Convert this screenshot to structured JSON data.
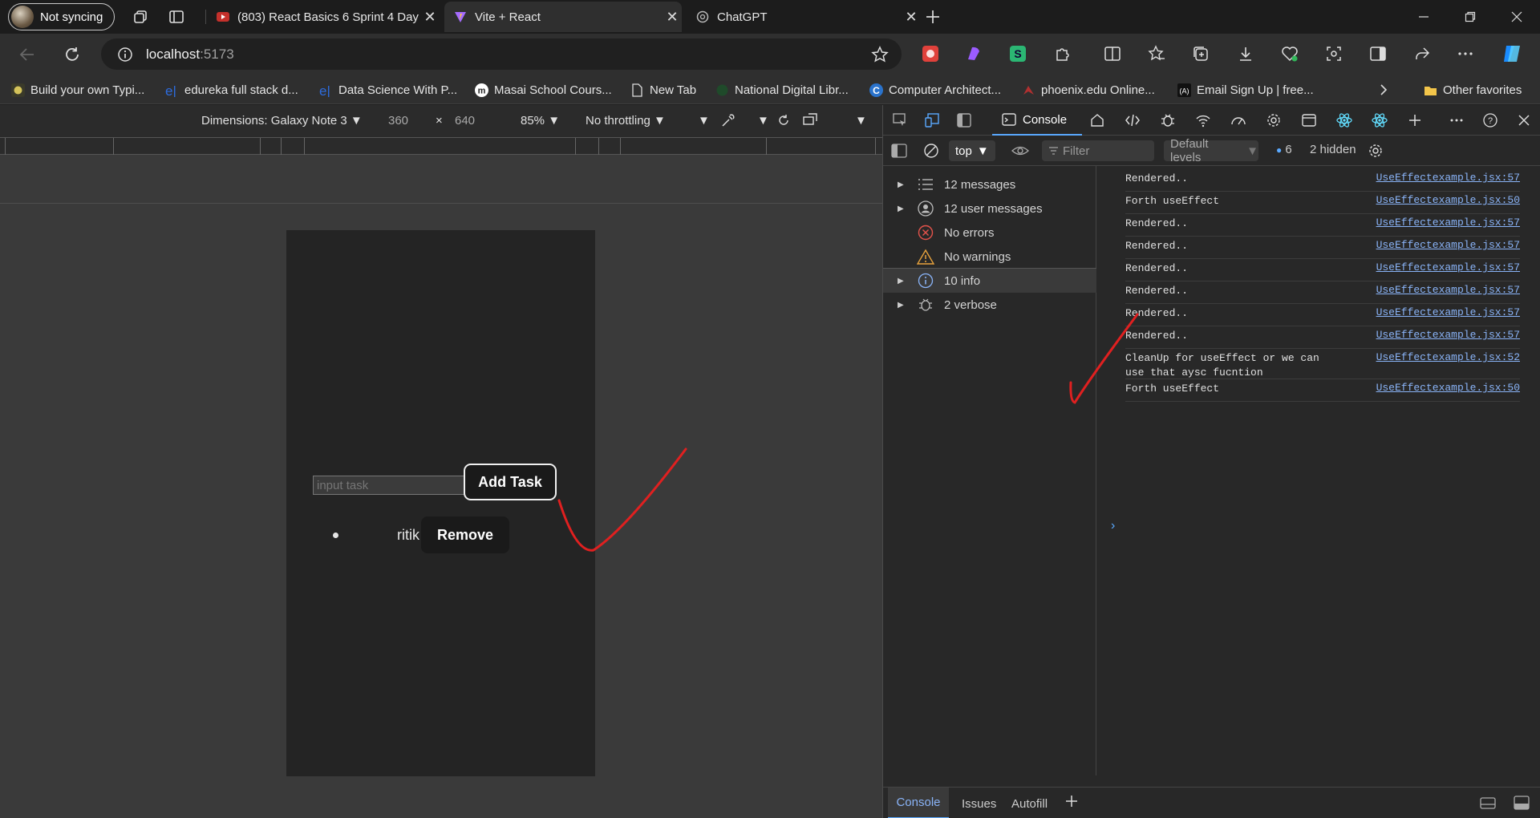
{
  "profile": {
    "label": "Not syncing"
  },
  "tabs": [
    {
      "title": "(803) React Basics 6 Sprint 4 Day (",
      "active": false
    },
    {
      "title": "Vite + React",
      "active": true
    },
    {
      "title": "ChatGPT",
      "active": false
    }
  ],
  "address": {
    "host": "localhost",
    "port": ":5173"
  },
  "favorites": [
    {
      "label": "Build your own Typi..."
    },
    {
      "label": "edureka full stack d..."
    },
    {
      "label": "Data Science With P..."
    },
    {
      "label": "Masai School Cours..."
    },
    {
      "label": "New Tab"
    },
    {
      "label": "National Digital Libr..."
    },
    {
      "label": "Computer Architect..."
    },
    {
      "label": "phoenix.edu Online..."
    },
    {
      "label": "Email Sign Up | free..."
    },
    {
      "label": "Other favorites"
    }
  ],
  "device_toolbar": {
    "dimensions": "Dimensions: Galaxy Note 3",
    "width": "360",
    "times": "×",
    "height": "640",
    "zoom": "85%",
    "throttling": "No throttling"
  },
  "app": {
    "input_placeholder": "input task",
    "add_button": "Add Task",
    "tasks": [
      {
        "name": "ritik",
        "remove_label": "Remove"
      }
    ]
  },
  "devtools": {
    "console_tab": "Console",
    "context": "top",
    "filter_placeholder": "Filter",
    "levels": "Default levels",
    "issues_count": "6",
    "hidden": "2 hidden",
    "sidebar": [
      {
        "label": "12 messages",
        "icon": "list-icon",
        "expandable": true
      },
      {
        "label": "12 user messages",
        "icon": "user-icon",
        "expandable": true
      },
      {
        "label": "No errors",
        "icon": "error-icon",
        "expandable": false
      },
      {
        "label": "No warnings",
        "icon": "warning-icon",
        "expandable": false
      },
      {
        "label": "10 info",
        "icon": "info-icon",
        "expandable": true,
        "selected": true
      },
      {
        "label": "2 verbose",
        "icon": "bug-icon",
        "expandable": true
      }
    ],
    "logs": [
      {
        "msg": "Rendered..",
        "src": "UseEffectexample.jsx:57"
      },
      {
        "msg": "Forth useEffect",
        "src": "UseEffectexample.jsx:50"
      },
      {
        "msg": "Rendered..",
        "src": "UseEffectexample.jsx:57"
      },
      {
        "msg": "Rendered..",
        "src": "UseEffectexample.jsx:57"
      },
      {
        "msg": "Rendered..",
        "src": "UseEffectexample.jsx:57"
      },
      {
        "msg": "Rendered..",
        "src": "UseEffectexample.jsx:57"
      },
      {
        "msg": "Rendered..",
        "src": "UseEffectexample.jsx:57"
      },
      {
        "msg": "Rendered..",
        "src": "UseEffectexample.jsx:57"
      },
      {
        "msg": "CleanUp for useEffect or we can use that aysc fucntion",
        "src": "UseEffectexample.jsx:52"
      },
      {
        "msg": "Forth useEffect",
        "src": "UseEffectexample.jsx:50"
      }
    ],
    "drawer_tabs": [
      "Console",
      "Issues",
      "Autofill"
    ]
  },
  "colors": {
    "accent": "#5aa9ff",
    "annotation": "#e02020"
  }
}
